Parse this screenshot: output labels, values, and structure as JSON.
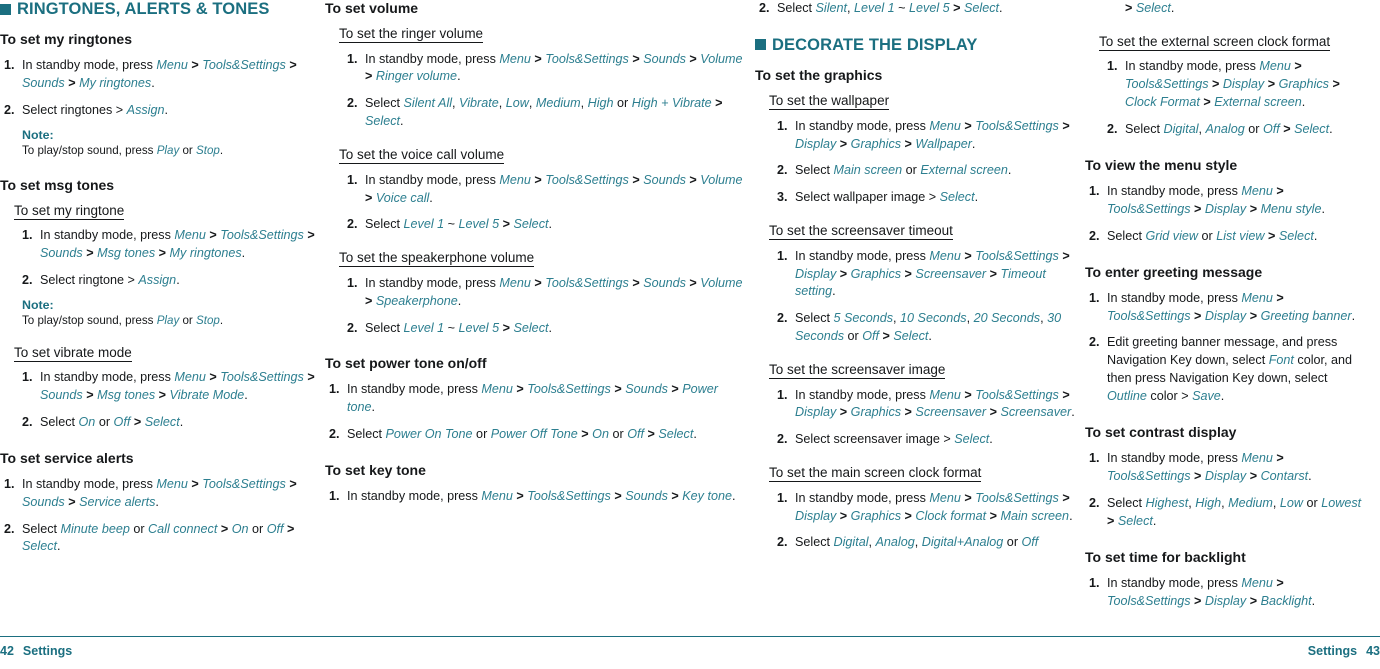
{
  "page": {
    "footer_left_number": "42",
    "footer_left_label": "Settings",
    "footer_right_label": "Settings",
    "footer_right_number": "43",
    "accent_color": "#1b6f80",
    "link_color": "#2d7f90"
  },
  "col1": {
    "section_title": "RINGTONES, ALERTS & TONES",
    "h_ringtones": "To set my ringtones",
    "s1_num": "1.",
    "s1_a": "In standby mode, press ",
    "s1_b": "Menu",
    "s1_c": " > ",
    "s1_d": "Tools&Settings",
    "s1_e": " > ",
    "s1_f": "Sounds",
    "s1_g": " > ",
    "s1_h": "My ringtones",
    "s1_i": ".",
    "s2_num": "2.",
    "s2_a": "Select ringtones > ",
    "s2_b": "Assign",
    "s2_c": ".",
    "note_label": "Note:",
    "note_a": "To play/stop sound, press ",
    "note_b": "Play",
    "note_c": " or ",
    "note_d": "Stop",
    "note_e": ".",
    "h_msgtones": "To set msg tones",
    "h_myringtone": "To set my ringtone",
    "m1_num": "1.",
    "m1_a": "In standby mode, press ",
    "m1_b": "Menu",
    "m1_c": " > ",
    "m1_d": "Tools&Settings",
    "m1_e": " > ",
    "m1_f": "Sounds",
    "m1_g": " > ",
    "m1_h": "Msg tones",
    "m1_i": " > ",
    "m1_j": "My ringtones",
    "m1_k": ".",
    "m2_num": "2.",
    "m2_a": "Select ringtone > ",
    "m2_b": "Assign",
    "m2_c": ".",
    "note2_label": "Note:",
    "note2_a": "To play/stop sound, press ",
    "note2_b": "Play",
    "note2_c": " or ",
    "note2_d": "Stop",
    "note2_e": ".",
    "h_vibrate": "To set vibrate mode",
    "v1_num": "1.",
    "v1_a": "In standby mode, press ",
    "v1_b": "Menu",
    "v1_c": " > ",
    "v1_d": "Tools&Settings",
    "v1_e": " > ",
    "v1_f": "Sounds",
    "v1_g": " > ",
    "v1_h": "Msg tones",
    "v1_i": " > ",
    "v1_j": "Vibrate Mode",
    "v1_k": ".",
    "v2_num": "2.",
    "v2_a": "Select ",
    "v2_b": "On",
    "v2_c": " or ",
    "v2_d": "Off",
    "v2_e": " > ",
    "v2_f": "Select",
    "v2_g": ".",
    "h_service": "To set service alerts",
    "sa1_num": "1.",
    "sa1_a": "In standby mode, press ",
    "sa1_b": "Menu",
    "sa1_c": " > ",
    "sa1_d": "Tools&Settings",
    "sa1_e": " > ",
    "sa1_f": "Sounds",
    "sa1_g": " > ",
    "sa1_h": "Service alerts",
    "sa1_i": ".",
    "sa2_num": "2.",
    "sa2_a": "Select ",
    "sa2_b": "Minute beep",
    "sa2_c": " or ",
    "sa2_d": "Call connect",
    "sa2_e": " > ",
    "sa2_f": "On",
    "sa2_g": " or ",
    "sa2_h": "Off",
    "sa2_i": " > ",
    "sa2_j": "Select",
    "sa2_k": "."
  },
  "col2": {
    "h_volume": "To set volume",
    "h_ringer": "To set the ringer volume",
    "r1_num": "1.",
    "r1_a": "In standby mode, press ",
    "r1_b": "Menu",
    "r1_c": " > ",
    "r1_d": "Tools&Settings",
    "r1_e": " > ",
    "r1_f": "Sounds",
    "r1_g": " > ",
    "r1_h": "Volume",
    "r1_i": " > ",
    "r1_j": "Ringer volume",
    "r1_k": ".",
    "r2_num": "2.",
    "r2_a": "Select ",
    "r2_b": "Silent All",
    "r2_c": ", ",
    "r2_d": "Vibrate",
    "r2_e": ", ",
    "r2_f": "Low",
    "r2_g": ", ",
    "r2_h": "Medium",
    "r2_i": ", ",
    "r2_j": "High",
    "r2_k": " or ",
    "r2_l": "High + Vibrate",
    "r2_m": " > ",
    "r2_n": "Select",
    "r2_o": ".",
    "h_voice": "To set the voice call volume",
    "vc1_num": "1.",
    "vc1_a": "In standby mode, press ",
    "vc1_b": "Menu",
    "vc1_c": " > ",
    "vc1_d": "Tools&Settings",
    "vc1_e": " > ",
    "vc1_f": "Sounds",
    "vc1_g": " > ",
    "vc1_h": "Volume",
    "vc1_i": " > ",
    "vc1_j": "Voice call",
    "vc1_k": ".",
    "vc2_num": "2.",
    "vc2_a": "Select ",
    "vc2_b": "Level 1",
    "vc2_c": " ~ ",
    "vc2_d": "Level 5",
    "vc2_e": " > ",
    "vc2_f": "Select",
    "vc2_g": ".",
    "h_speaker": "To set the speakerphone volume",
    "sp1_num": "1.",
    "sp1_a": "In standby mode, press ",
    "sp1_b": "Menu",
    "sp1_c": " > ",
    "sp1_d": "Tools&Settings",
    "sp1_e": " > ",
    "sp1_f": "Sounds",
    "sp1_g": " > ",
    "sp1_h": "Volume",
    "sp1_i": " > ",
    "sp1_j": "Speakerphone",
    "sp1_k": ".",
    "sp2_num": "2.",
    "sp2_a": "Select ",
    "sp2_b": "Level 1",
    "sp2_c": " ~ ",
    "sp2_d": "Level 5",
    "sp2_e": " > ",
    "sp2_f": "Select",
    "sp2_g": ".",
    "h_power": "To set power tone on/off",
    "p1_num": "1.",
    "p1_a": "In standby mode, press ",
    "p1_b": "Menu",
    "p1_c": " > ",
    "p1_d": "Tools&Settings",
    "p1_e": " > ",
    "p1_f": "Sounds",
    "p1_g": " > ",
    "p1_h": "Power tone",
    "p1_i": ".",
    "p2_num": "2.",
    "p2_a": "Select ",
    "p2_b": "Power On Tone",
    "p2_c": " or ",
    "p2_d": "Power Off Tone",
    "p2_e": " > ",
    "p2_f": "On",
    "p2_g": " or ",
    "p2_h": "Off",
    "p2_i": " > ",
    "p2_j": "Select",
    "p2_k": ".",
    "h_key": "To set key tone",
    "k1_num": "1.",
    "k1_a": "In standby mode, press ",
    "k1_b": "Menu",
    "k1_c": " > ",
    "k1_d": "Tools&Settings",
    "k1_e": " > ",
    "k1_f": "Sounds",
    "k1_g": " > ",
    "k1_h": "Key tone",
    "k1_i": "."
  },
  "col3": {
    "k2_num": "2.",
    "k2_a": "Select ",
    "k2_b": "Silent",
    "k2_c": ", ",
    "k2_d": "Level 1",
    "k2_e": " ~ ",
    "k2_f": "Level 5",
    "k2_g": " > ",
    "k2_h": "Select",
    "k2_i": ".",
    "section_title": "DECORATE THE DISPLAY",
    "h_graphics": "To set the graphics",
    "h_wallpaper": "To set the wallpaper",
    "w1_num": "1.",
    "w1_a": "In standby mode, press ",
    "w1_b": "Menu",
    "w1_c": " > ",
    "w1_d": "Tools&Settings",
    "w1_e": " > ",
    "w1_f": "Display",
    "w1_g": " > ",
    "w1_h": "Graphics",
    "w1_i": " > ",
    "w1_j": "Wallpaper",
    "w1_k": ".",
    "w2_num": "2.",
    "w2_a": "Select ",
    "w2_b": "Main screen",
    "w2_c": " or ",
    "w2_d": "External screen",
    "w2_e": ".",
    "w3_num": "3.",
    "w3_a": "Select wallpaper image > ",
    "w3_b": "Select",
    "w3_c": ".",
    "h_sstimeout": "To set the screensaver timeout",
    "st1_num": "1.",
    "st1_a": "In standby mode, press ",
    "st1_b": "Menu",
    "st1_c": " > ",
    "st1_d": "Tools&Settings",
    "st1_e": " > ",
    "st1_f": "Display",
    "st1_g": " > ",
    "st1_h": "Graphics",
    "st1_i": " > ",
    "st1_j": "Screensaver",
    "st1_k": " > ",
    "st1_l": "Timeout setting",
    "st1_m": ".",
    "st2_num": "2.",
    "st2_a": "Select ",
    "st2_b": "5 Seconds",
    "st2_c": ", ",
    "st2_d": "10 Seconds",
    "st2_e": ", ",
    "st2_f": "20 Seconds",
    "st2_g": ", ",
    "st2_h": "30 Seconds",
    "st2_i": " or ",
    "st2_j": "Off",
    "st2_k": " > ",
    "st2_l": "Select",
    "st2_m": ".",
    "h_ssimage": "To set the screensaver image",
    "si1_num": "1.",
    "si1_a": "In standby mode, press ",
    "si1_b": "Menu",
    "si1_c": " > ",
    "si1_d": "Tools&Settings",
    "si1_e": " > ",
    "si1_f": "Display",
    "si1_g": " > ",
    "si1_h": "Graphics",
    "si1_i": " > ",
    "si1_j": "Screensaver",
    "si1_k": " > ",
    "si1_l": "Screensaver",
    "si1_m": ".",
    "si2_num": "2.",
    "si2_a": "Select screensaver image > ",
    "si2_b": "Select",
    "si2_c": ".",
    "h_mainclock": "To set the main screen clock format",
    "mc1_num": "1.",
    "mc1_a": "In standby mode, press ",
    "mc1_b": "Menu",
    "mc1_c": " > ",
    "mc1_d": "Tools&Settings",
    "mc1_e": " > ",
    "mc1_f": "Display",
    "mc1_g": " > ",
    "mc1_h": "Graphics",
    "mc1_i": " > ",
    "mc1_j": "Clock format",
    "mc1_k": " > ",
    "mc1_l": "Main screen",
    "mc1_m": ".",
    "mc2_num": "2.",
    "mc2_a": "Select ",
    "mc2_b": "Digital",
    "mc2_c": ", ",
    "mc2_d": "Analog",
    "mc2_e": ", ",
    "mc2_f": "Digital+Analog",
    "mc2_g": " or ",
    "mc2_h": "Off"
  },
  "col4": {
    "cont_a": "> ",
    "cont_b": "Select",
    "cont_c": ".",
    "h_extclock": "To set the external screen clock format",
    "ec1_num": "1.",
    "ec1_a": "In standby mode, press ",
    "ec1_b": "Menu",
    "ec1_c": " > ",
    "ec1_d": "Tools&Settings",
    "ec1_e": " > ",
    "ec1_f": "Display",
    "ec1_g": " > ",
    "ec1_h": "Graphics",
    "ec1_i": " > ",
    "ec1_j": "Clock Format",
    "ec1_k": " > ",
    "ec1_l": "External screen",
    "ec1_m": ".",
    "ec2_num": "2.",
    "ec2_a": "Select ",
    "ec2_b": "Digital",
    "ec2_c": ", ",
    "ec2_d": "Analog",
    "ec2_e": " or ",
    "ec2_f": "Off",
    "ec2_g": " > ",
    "ec2_h": "Select",
    "ec2_i": ".",
    "h_menustyle": "To view the menu style",
    "ms1_num": "1.",
    "ms1_a": "In standby mode, press ",
    "ms1_b": "Menu",
    "ms1_c": " > ",
    "ms1_d": "Tools&Settings",
    "ms1_e": " > ",
    "ms1_f": "Display",
    "ms1_g": " > ",
    "ms1_h": "Menu style",
    "ms1_i": ".",
    "ms2_num": "2.",
    "ms2_a": "Select ",
    "ms2_b": "Grid view",
    "ms2_c": " or ",
    "ms2_d": "List view",
    "ms2_e": " > ",
    "ms2_f": "Select",
    "ms2_g": ".",
    "h_greeting": "To enter greeting message",
    "g1_num": "1.",
    "g1_a": "In standby mode, press ",
    "g1_b": "Menu",
    "g1_c": " > ",
    "g1_d": "Tools&Settings",
    "g1_e": " > ",
    "g1_f": "Display",
    "g1_g": " > ",
    "g1_h": "Greeting banner",
    "g1_i": ".",
    "g2_num": "2.",
    "g2_a": "Edit greeting banner message, and press Navigation Key down, select ",
    "g2_b": "Font",
    "g2_c": " color, and then press Navigation Key down, select ",
    "g2_d": "Outline",
    "g2_e": " color > ",
    "g2_f": "Save",
    "g2_g": ".",
    "h_contrast": "To set contrast display",
    "c1_num": "1.",
    "c1_a": "In standby mode, press ",
    "c1_b": "Menu",
    "c1_c": " > ",
    "c1_d": "Tools&Settings",
    "c1_e": " > ",
    "c1_f": "Display",
    "c1_g": " > ",
    "c1_h": "Contarst",
    "c1_i": ".",
    "c2_num": "2.",
    "c2_a": "Select ",
    "c2_b": "Highest",
    "c2_c": ", ",
    "c2_d": "High",
    "c2_e": ", ",
    "c2_f": "Medium",
    "c2_g": ", ",
    "c2_h": "Low",
    "c2_i": " or ",
    "c2_j": "Lowest",
    "c2_k": " > ",
    "c2_l": "Select",
    "c2_m": ".",
    "h_backlight": "To set time for backlight",
    "b1_num": "1.",
    "b1_a": "In standby mode, press ",
    "b1_b": "Menu",
    "b1_c": " > ",
    "b1_d": "Tools&Settings",
    "b1_e": " > ",
    "b1_f": "Display",
    "b1_g": " > ",
    "b1_h": "Backlight",
    "b1_i": "."
  }
}
